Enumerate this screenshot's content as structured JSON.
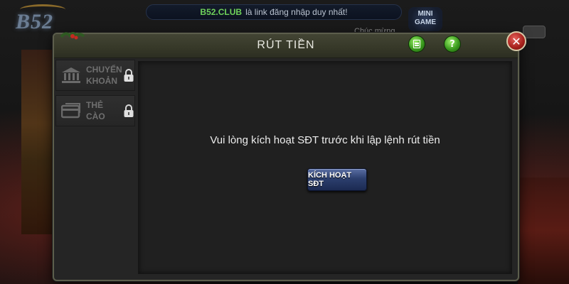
{
  "background": {
    "top_banner": {
      "site": "B52.CLUB",
      "text": "là link đăng nhập duy nhất!"
    },
    "logo_text": "B52",
    "minigame_label": "MINI GAME",
    "greeting": "Chúc mừng"
  },
  "modal": {
    "title": "RÚT TIỀN",
    "icons": {
      "doc": "document-icon",
      "help": "help-icon",
      "close": "close-icon"
    },
    "help_glyph": "?",
    "close_glyph": "✕",
    "sidebar": {
      "items": [
        {
          "label_line1": "CHUYỂN",
          "label_line2": "KHOẢN",
          "icon": "bank-icon",
          "locked": true
        },
        {
          "label_line1": "THẺ CÀO",
          "label_line2": "",
          "icon": "card-icon",
          "locked": true
        }
      ]
    },
    "main": {
      "message": "Vui lòng kích hoạt SĐT trước khi lập lệnh rút tiền",
      "button_label": "KÍCH HOẠT SĐT"
    }
  },
  "colors": {
    "header": "#3a3c2c",
    "panel": "#202020",
    "button": "#2c3f6e",
    "close": "#a5201b",
    "icon_green": "#3a9a1e"
  }
}
